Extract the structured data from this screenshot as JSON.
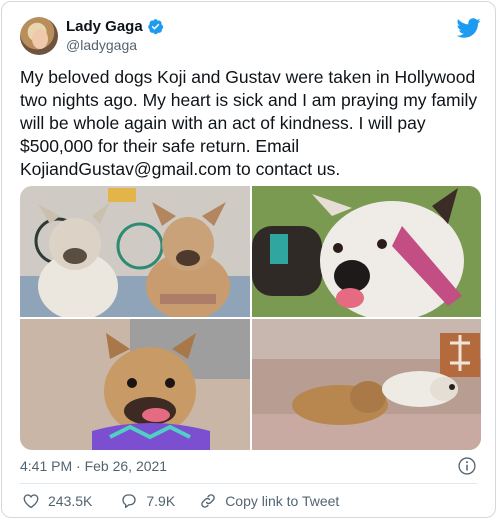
{
  "author": {
    "name": "Lady Gaga",
    "handle": "@ladygaga"
  },
  "tweet": {
    "text": "My beloved dogs Koji and Gustav were taken in Hollywood\ntwo nights ago. My heart is sick and I am praying my family\nwill be whole again with an act of kindness. I will pay\n$500,000 for their safe return. Email\nKojiandGustav@gmail.com to contact us.",
    "timestamp": "4:41 PM · Feb 26, 2021"
  },
  "actions": {
    "likes": "243.5K",
    "replies": "7.9K",
    "copy_link": "Copy link to Tweet"
  },
  "colors": {
    "brand": "#1d9bf0",
    "text": "#0f1419",
    "secondary": "#536471"
  },
  "icons": [
    "verified-badge-icon",
    "twitter-bird-icon",
    "info-icon",
    "heart-icon",
    "reply-bubble-icon",
    "link-icon"
  ]
}
